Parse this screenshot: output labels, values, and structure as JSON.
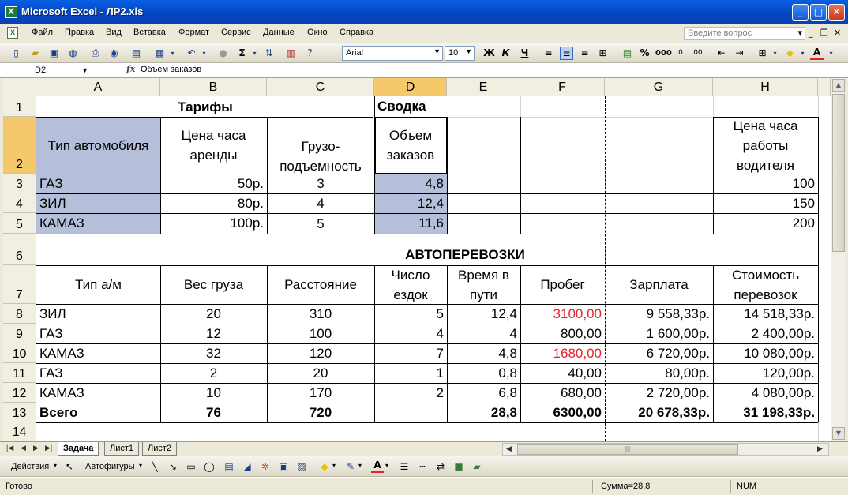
{
  "window": {
    "title": "Microsoft Excel - ЛР2.xls",
    "app_icon": "X"
  },
  "menu": {
    "items": [
      "Файл",
      "Правка",
      "Вид",
      "Вставка",
      "Формат",
      "Сервис",
      "Данные",
      "Окно",
      "Справка"
    ],
    "help_placeholder": "Введите вопрос"
  },
  "toolbar": {
    "font": "Arial",
    "size": "10",
    "bold": "Ж",
    "italic": "К",
    "underline": "Ч",
    "sum": "Σ"
  },
  "formula_bar": {
    "name_box": "D2",
    "fx": "fx",
    "formula": "Объем заказов"
  },
  "columns": [
    "A",
    "B",
    "C",
    "D",
    "E",
    "F",
    "G",
    "H"
  ],
  "rows": [
    "1",
    "2",
    "3",
    "4",
    "5",
    "6",
    "7",
    "8",
    "9",
    "10",
    "11",
    "12",
    "13",
    "14"
  ],
  "sheet": {
    "r1": {
      "tariffs": "Тарифы",
      "summary": "Сводка"
    },
    "r2": {
      "a": "Тип автомобиля",
      "b": "Цена часа аренды",
      "c": "Грузо-подъемность",
      "d": "Объем заказов",
      "h": "Цена часа работы водителя"
    },
    "r3": {
      "a": "ГАЗ",
      "b": "50р.",
      "c": "3",
      "d": "4,8",
      "h": "100"
    },
    "r4": {
      "a": "ЗИЛ",
      "b": "80р.",
      "c": "4",
      "d": "12,4",
      "h": "150"
    },
    "r5": {
      "a": "КАМАЗ",
      "b": "100р.",
      "c": "5",
      "d": "11,6",
      "h": "200"
    },
    "r6": {
      "title": "АВТОПЕРЕВОЗКИ"
    },
    "r7": {
      "a": "Тип а/м",
      "b": "Вес груза",
      "c": "Расстояние",
      "d": "Число ездок",
      "e": "Время в пути",
      "f": "Пробег",
      "g": "Зарплата",
      "h": "Стоимость перевозок"
    },
    "r8": {
      "a": "ЗИЛ",
      "b": "20",
      "c": "310",
      "d": "5",
      "e": "12,4",
      "f": "3100,00",
      "g": "9 558,33р.",
      "h": "14 518,33р."
    },
    "r9": {
      "a": "ГАЗ",
      "b": "12",
      "c": "100",
      "d": "4",
      "e": "4",
      "f": "800,00",
      "g": "1 600,00р.",
      "h": "2 400,00р."
    },
    "r10": {
      "a": "КАМАЗ",
      "b": "32",
      "c": "120",
      "d": "7",
      "e": "4,8",
      "f": "1680,00",
      "g": "6 720,00р.",
      "h": "10 080,00р."
    },
    "r11": {
      "a": "ГАЗ",
      "b": "2",
      "c": "20",
      "d": "1",
      "e": "0,8",
      "f": "40,00",
      "g": "80,00р.",
      "h": "120,00р."
    },
    "r12": {
      "a": "КАМАЗ",
      "b": "10",
      "c": "170",
      "d": "2",
      "e": "6,8",
      "f": "680,00",
      "g": "2 720,00р.",
      "h": "4 080,00р."
    },
    "r13": {
      "a": "Всего",
      "b": "76",
      "c": "720",
      "e": "28,8",
      "f": "6300,00",
      "g": "20 678,33р.",
      "h": "31 198,33р."
    }
  },
  "colors": {
    "highlight_fill": "#b5bfd9",
    "red_text": "#e8202a",
    "selected_header": "#f5c86a"
  },
  "tabs": [
    "Задача",
    "Лист1",
    "Лист2"
  ],
  "drawing": {
    "actions": "Действия",
    "autoshapes": "Автофигуры"
  },
  "status": {
    "ready": "Готово",
    "sum": "Сумма=28,8",
    "num": "NUM"
  }
}
